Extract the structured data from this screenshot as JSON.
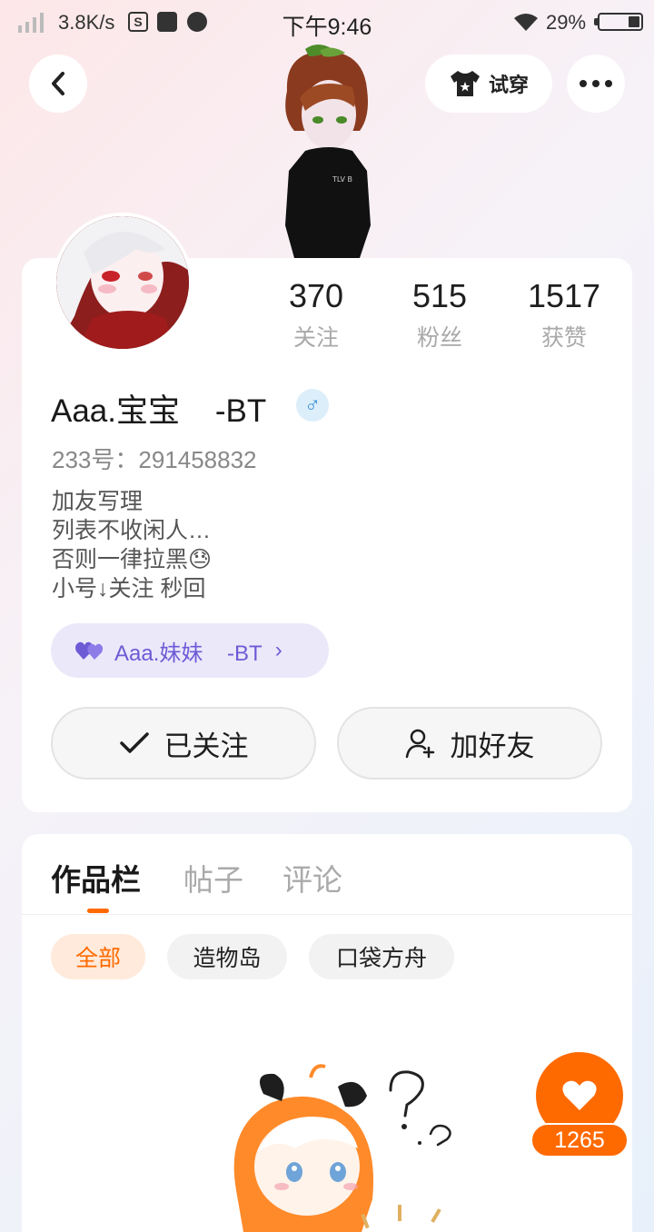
{
  "status_bar": {
    "net_speed": "3.8K/s",
    "time": "下午9:46",
    "battery": "29%",
    "battery_level": 0.29
  },
  "nav": {
    "try_on_label": "试穿"
  },
  "profile": {
    "stats": [
      {
        "value": "370",
        "label": "关注"
      },
      {
        "value": "515",
        "label": "粉丝"
      },
      {
        "value": "1517",
        "label": "获赞"
      }
    ],
    "username": "Aaa.宝宝    -BT",
    "gender_symbol": "♂",
    "uid": "233号：291458832",
    "bio": [
      "加友写理",
      "列表不收闲人…",
      "否则一律拉黑😓",
      "小号↓关注 秒回"
    ],
    "cp_name": "Aaa.妹妹    -BT",
    "cp_chevron": "›",
    "follow_label": "已关注",
    "add_friend_label": "加好友"
  },
  "tabs": [
    {
      "label": "作品栏",
      "active": true
    },
    {
      "label": "帖子",
      "active": false
    },
    {
      "label": "评论",
      "active": false
    }
  ],
  "filters": [
    {
      "label": "全部",
      "active": true
    },
    {
      "label": "造物岛",
      "active": false
    },
    {
      "label": "口袋方舟",
      "active": false
    }
  ],
  "like": {
    "count": "1265"
  },
  "colors": {
    "accent": "#ff6a00",
    "cp_text": "#6d5bd6",
    "gender": "#3a8fd8"
  }
}
